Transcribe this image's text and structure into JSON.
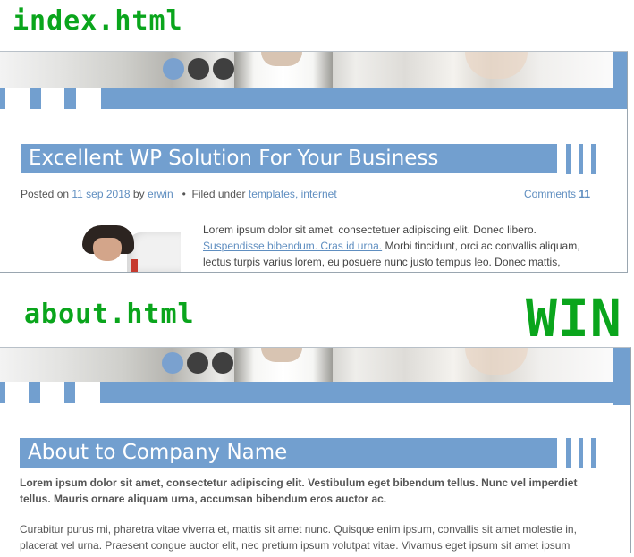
{
  "labels": {
    "index": "index.html",
    "about": "about.html",
    "win": "WIN"
  },
  "index_page": {
    "post_title": "Excellent WP Solution For Your Business",
    "meta": {
      "posted_on": "Posted on",
      "date": "11 sep 2018",
      "by": "by",
      "author": "erwin",
      "bullet": "•",
      "filed_under": "Filed under",
      "category_1": "templates",
      "comma": ",",
      "category_2": "internet",
      "comments_label": "Comments",
      "comments_count": "11"
    },
    "excerpt": {
      "line1": "Lorem ipsum dolor sit amet, consectetuer adipiscing elit. Donec libero.",
      "link": "Suspendisse bibendum. Cras id urna.",
      "line2_rest": " Morbi tincidunt, orci ac convallis aliquam,",
      "line3": "lectus turpis varius lorem, eu posuere nunc justo tempus leo. Donec mattis,"
    }
  },
  "about_page": {
    "title": "About to Company Name",
    "intro_line1": "Lorem ipsum dolor sit amet, consectetur adipiscing elit. Vestibulum eget bibendum tellus. Nunc vel imperdiet",
    "intro_line2": "tellus. Mauris ornare aliquam urna, accumsan bibendum eros auctor ac.",
    "para_line1": "Curabitur purus mi, pharetra vitae viverra et, mattis sit amet nunc. Quisque enim ipsum, convallis sit amet molestie in,",
    "para_line2": "placerat vel urna. Praesent congue auctor elit, nec pretium ipsum volutpat vitae. Vivamus eget ipsum sit amet ipsum"
  },
  "slider": {
    "dots": 3,
    "active_index": 0
  },
  "colors": {
    "accent": "#729fcf",
    "label_green": "#0aa51c",
    "link": "#5f8ec0"
  }
}
